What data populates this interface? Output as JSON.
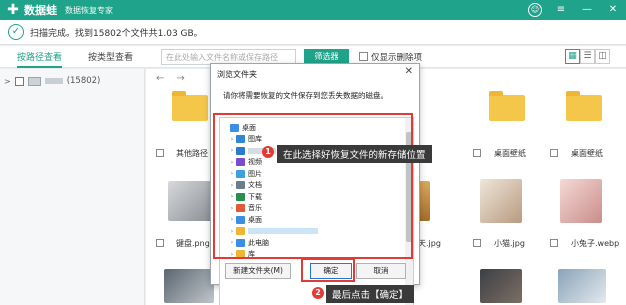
{
  "app": {
    "name": "数据蛙",
    "subtitle": "数据恢复专家"
  },
  "status": {
    "text": "扫描完成。找到15802个文件共1.03 GB。"
  },
  "toolbar": {
    "tab_path": "按路径查看",
    "tab_type": "按类型查看",
    "search_placeholder": "在此处输入文件名称或保存路径",
    "filter_label": "筛选器",
    "show_deleted_label": "仅显示删除项"
  },
  "sidebar": {
    "root_count": "(15802)"
  },
  "grid": {
    "items": [
      {
        "name": "其他路径"
      },
      {
        "name": "桌面壁纸"
      },
      {
        "name": "桌面壁纸"
      },
      {
        "name": "键盘.png"
      },
      {
        "name": "天.jpg"
      },
      {
        "name": "小猫.jpg"
      },
      {
        "name": "小兔子.webp"
      }
    ]
  },
  "dialog": {
    "title": "浏览文件夹",
    "description": "请你将需要恢复的文件保存到您丢失数据的磁盘。",
    "tree": [
      {
        "label": "桌面",
        "icon": "desktop-icon",
        "color": "#3a8ee6"
      },
      {
        "label": "图库",
        "icon": "gallery-icon",
        "color": "#2f88d6"
      },
      {
        "label": "",
        "icon": "cloud-icon",
        "color": "#2b79d1"
      },
      {
        "label": "视频",
        "icon": "video-icon",
        "color": "#7b4bd2"
      },
      {
        "label": "图片",
        "icon": "picture-icon",
        "color": "#3aa0e0"
      },
      {
        "label": "文档",
        "icon": "document-icon",
        "color": "#6b7d8a"
      },
      {
        "label": "下载",
        "icon": "download-icon",
        "color": "#2a8f4e"
      },
      {
        "label": "音乐",
        "icon": "music-icon",
        "color": "#e05a3a"
      },
      {
        "label": "桌面",
        "icon": "desktop-icon",
        "color": "#3a8ee6"
      },
      {
        "label": "",
        "icon": "folder-icon",
        "color": "#f0b534"
      },
      {
        "label": "此电脑",
        "icon": "computer-icon",
        "color": "#3a8ee6"
      },
      {
        "label": "库",
        "icon": "library-icon",
        "color": "#f0b534"
      }
    ],
    "new_folder_label": "新建文件夹(M)",
    "ok_label": "确定",
    "cancel_label": "取消"
  },
  "annotations": {
    "step1_number": "1",
    "step1_text": "在此选择好恢复文件的新存储位置",
    "step2_number": "2",
    "step2_text": "最后点击【确定】"
  },
  "colors": {
    "brand": "#1fa38a",
    "annotation_red": "#e53935"
  }
}
